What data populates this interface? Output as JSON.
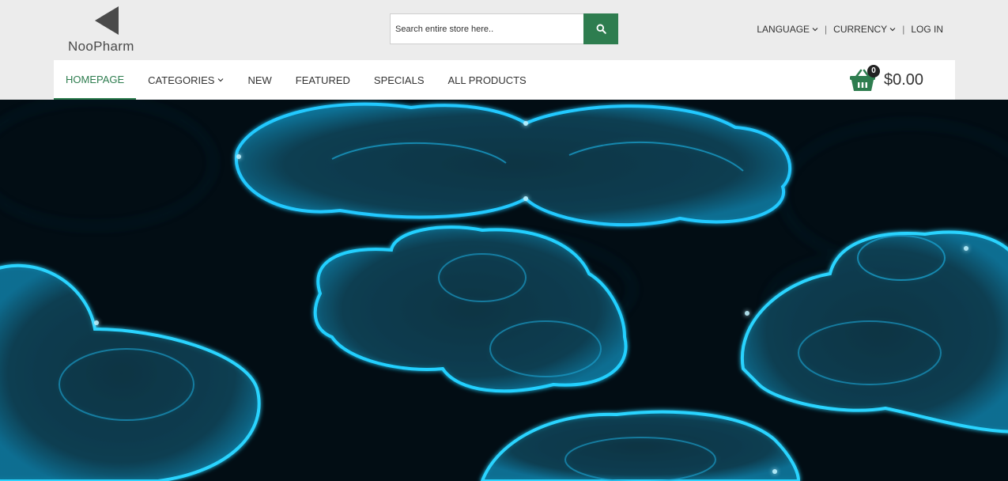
{
  "brand": {
    "name": "NooPharm"
  },
  "search": {
    "placeholder": "Search entire store here..",
    "value": ""
  },
  "top_links": {
    "language": "LANGUAGE",
    "currency": "CURRENCY",
    "login": "LOG IN",
    "separator": "|"
  },
  "nav": {
    "items": [
      {
        "label": "HOMEPAGE",
        "active": true
      },
      {
        "label": "CATEGORIES",
        "dropdown": true
      },
      {
        "label": "NEW"
      },
      {
        "label": "FEATURED"
      },
      {
        "label": "SPECIALS"
      },
      {
        "label": "ALL PRODUCTS"
      }
    ]
  },
  "cart": {
    "count": "0",
    "total": "$0.00"
  },
  "hero": {
    "description": "glowing blue cell banner"
  },
  "colors": {
    "accent": "#2e7d4f",
    "background": "#ececec",
    "glow": "#1cc8ff",
    "hero_dark": "#020d14"
  },
  "icons": {
    "logo": "triangle-logo-icon",
    "search": "search-icon",
    "dropdown": "chevron-down-icon",
    "cart": "basket-icon"
  }
}
